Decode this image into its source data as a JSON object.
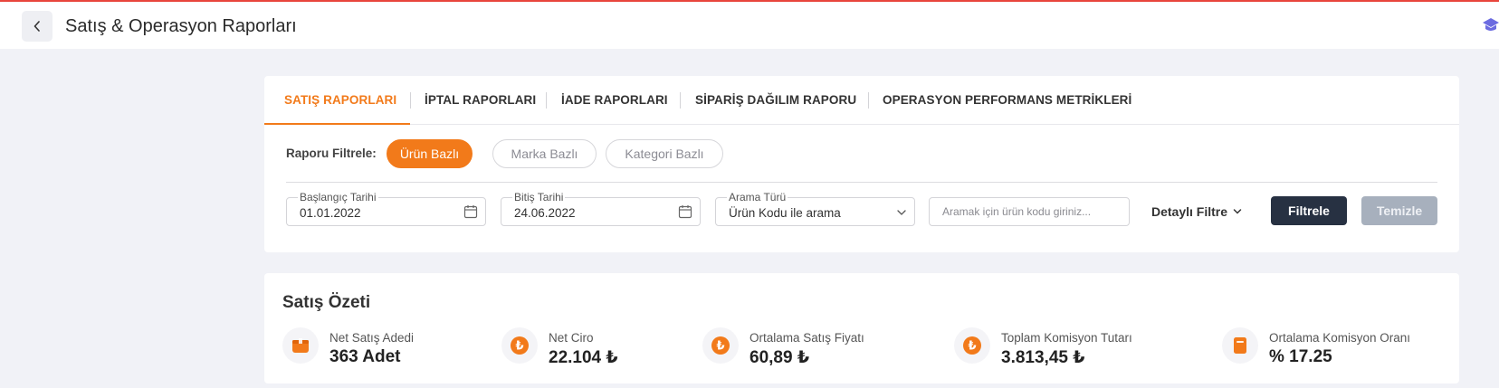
{
  "header": {
    "title": "Satış & Operasyon Raporları",
    "accent_color": "#e8453c"
  },
  "tabs": [
    {
      "label": "SATIŞ RAPORLARI",
      "active": true
    },
    {
      "label": "İPTAL RAPORLARI",
      "active": false
    },
    {
      "label": "İADE RAPORLARI",
      "active": false
    },
    {
      "label": "SİPARİŞ DAĞILIM RAPORU",
      "active": false
    },
    {
      "label": "OPERASYON PERFORMANS METRİKLERİ",
      "active": false
    }
  ],
  "filters": {
    "label": "Raporu Filtrele:",
    "chips": [
      {
        "label": "Ürün Bazlı",
        "active": true
      },
      {
        "label": "Marka Bazlı",
        "active": false
      },
      {
        "label": "Kategori Bazlı",
        "active": false
      }
    ],
    "start_date": {
      "legend": "Başlangıç Tarihi",
      "value": "01.01.2022"
    },
    "end_date": {
      "legend": "Bitiş Tarihi",
      "value": "24.06.2022"
    },
    "search_type": {
      "legend": "Arama Türü",
      "value": "Ürün Kodu ile arama"
    },
    "search": {
      "placeholder": "Aramak için ürün kodu giriniz..."
    },
    "detail_filter_label": "Detaylı Filtre",
    "filter_button": "Filtrele",
    "clear_button": "Temizle"
  },
  "summary": {
    "title": "Satış Özeti",
    "stats": [
      {
        "label": "Net Satış Adedi",
        "value": "363 Adet",
        "icon": "box-icon"
      },
      {
        "label": "Net Ciro",
        "value": "22.104 ₺",
        "icon": "lira-coin-icon"
      },
      {
        "label": "Ortalama Satış Fiyatı",
        "value": "60,89 ₺",
        "icon": "lira-coin-icon"
      },
      {
        "label": "Toplam Komisyon Tutarı",
        "value": "3.813,45 ₺",
        "icon": "lira-coin-icon"
      },
      {
        "label": "Ortalama Komisyon Oranı",
        "value": "% 17.25",
        "icon": "document-icon"
      }
    ]
  },
  "colors": {
    "brand_orange": "#f27a1a",
    "dark_button": "#273142",
    "disabled_button": "#a7b0bd",
    "background": "#f1f2f7"
  }
}
